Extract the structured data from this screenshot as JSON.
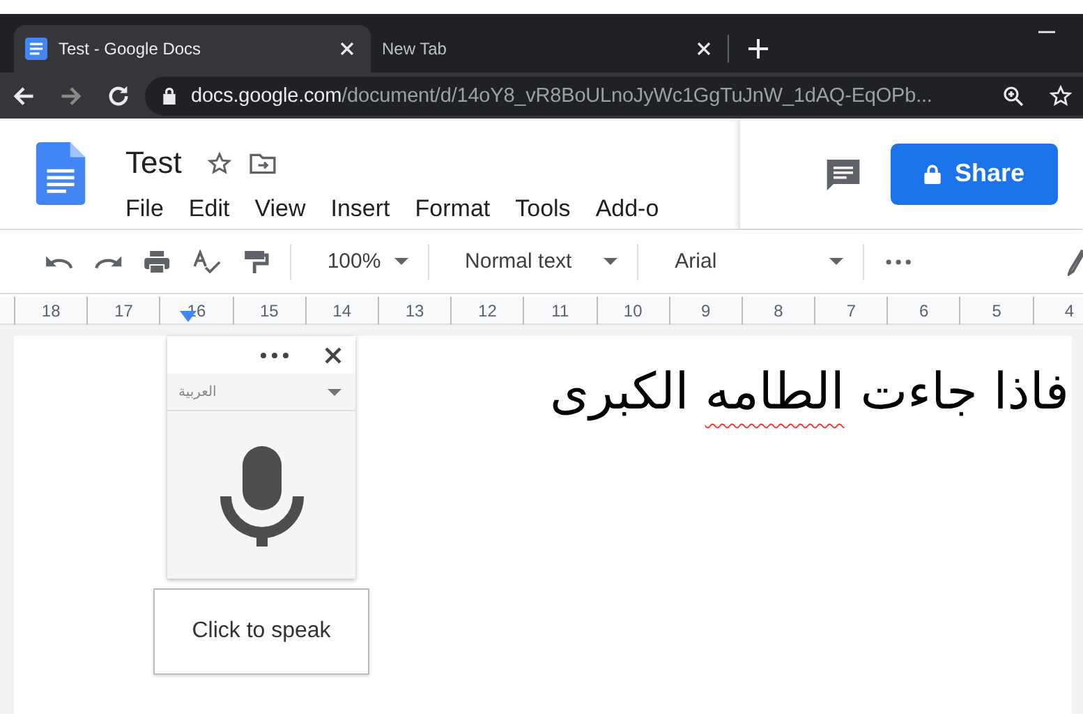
{
  "browser": {
    "tabs": [
      {
        "label": "Test - Google Docs",
        "selected": true
      },
      {
        "label": "New Tab",
        "selected": false
      }
    ],
    "url": {
      "host": "docs.google.com",
      "path": "/document/d/14oY8_vR8BoULnoJyWc1GgTuJnW_1dAQ-EqOPb..."
    }
  },
  "docs": {
    "title": "Test",
    "starred": false,
    "menu": [
      "File",
      "Edit",
      "View",
      "Insert",
      "Format",
      "Tools",
      "Add-o"
    ],
    "share_button": "Share",
    "toolbar": {
      "zoom": "100%",
      "style": "Normal text",
      "font": "Arial"
    },
    "ruler": [
      "18",
      "17",
      "16",
      "15",
      "14",
      "13",
      "12",
      "11",
      "10",
      "9",
      "8",
      "7",
      "6",
      "5",
      "4"
    ],
    "document_words": [
      {
        "text": "فاذا",
        "misspelled": false
      },
      {
        "text": "جاءت",
        "misspelled": false
      },
      {
        "text": "الطامه",
        "misspelled": true
      },
      {
        "text": "الكبرى",
        "misspelled": false
      }
    ]
  },
  "voice_typing": {
    "language": "العربية",
    "tooltip": "Click to speak"
  }
}
